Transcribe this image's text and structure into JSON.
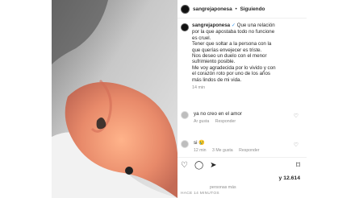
{
  "header": {
    "username": "sangrejaponesa",
    "separator": "•",
    "follow_label": "Siguiendo"
  },
  "caption": {
    "username": "sangrejaponesa",
    "verified_icon": "✓",
    "lines": [
      "Que una relación",
      "por la que apostaba todo no funcione",
      "es cruel.",
      "Tener que soltar a la persona con la",
      "que querías envejecer es triste.",
      "Nos deseo un duelo con el menor",
      "sufrimiento posible.",
      "Me voy agradecida por lo vivido y con",
      "el corazón roto por uno de los años",
      "más lindos de mi vida."
    ],
    "time": "14 min"
  },
  "comments": [
    {
      "text": "ya no creo en el amor",
      "time": "",
      "likes": "",
      "reply": "Responder"
    },
    {
      "text": "si 😢",
      "time": "12 min",
      "likes": "3 Me gusta",
      "reply": "Responder"
    }
  ],
  "comment1_meta": {
    "a": "Ar gusta",
    "reply": "Responder"
  },
  "stats": {
    "likes_count": "y 12.614",
    "liked_by_fragment": "personas más",
    "time_ago": "HACE 14 MINUTOS"
  }
}
